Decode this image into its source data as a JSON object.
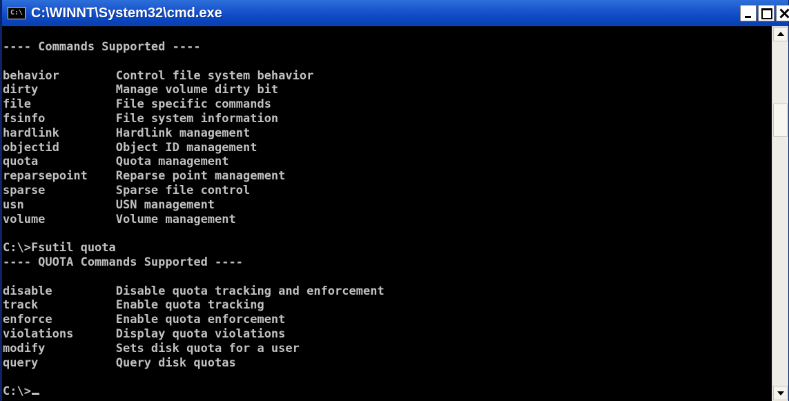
{
  "window": {
    "title": "C:\\WINNT\\System32\\cmd.exe",
    "icon_text": "C:\\"
  },
  "console": {
    "lines": [
      "---- Commands Supported ----",
      "",
      "behavior        Control file system behavior",
      "dirty           Manage volume dirty bit",
      "file            File specific commands",
      "fsinfo          File system information",
      "hardlink        Hardlink management",
      "objectid        Object ID management",
      "quota           Quota management",
      "reparsepoint    Reparse point management",
      "sparse          Sparse file control",
      "usn             USN management",
      "volume          Volume management",
      "",
      "C:\\>Fsutil quota",
      "---- QUOTA Commands Supported ----",
      "",
      "disable         Disable quota tracking and enforcement",
      "track           Enable quota tracking",
      "enforce         Enable quota enforcement",
      "violations      Display quota violations",
      "modify          Sets disk quota for a user",
      "query           Query disk quotas",
      ""
    ],
    "prompt": "C:\\>"
  },
  "colors": {
    "titlebar": "#0A47C2",
    "console_bg": "#000000",
    "console_fg": "#C0C0C0"
  },
  "icons": {
    "app": "console-app-icon",
    "minimize": "minimize-icon",
    "maximize": "maximize-icon",
    "close": "close-icon"
  }
}
